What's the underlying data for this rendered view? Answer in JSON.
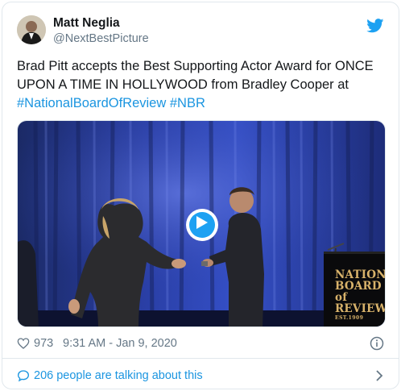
{
  "author": {
    "name": "Matt Neglia",
    "handle": "@NextBestPicture"
  },
  "tweet": {
    "text_plain": "Brad Pitt accepts the Best Supporting Actor Award for ONCE UPON A TIME IN HOLLYWOOD from Bradley Cooper at",
    "hashtags": [
      "#NationalBoardOfReview",
      "#NBR"
    ]
  },
  "media": {
    "type": "video",
    "sign_lines": [
      "NATIONA",
      "BOARD of",
      "REVIEW"
    ],
    "sign_est": "EST.1909"
  },
  "meta": {
    "like_count": "973",
    "timestamp": "9:31 AM - Jan 9, 2020"
  },
  "conversation": {
    "label": "206 people are talking about this"
  },
  "icons": {
    "bird": "twitter-bird-icon",
    "heart": "heart-icon",
    "info": "info-icon",
    "bubble": "chat-bubble-icon",
    "chevron": "chevron-right-icon",
    "play": "play-icon"
  },
  "colors": {
    "link": "#1b95e0",
    "brand": "#1da1f2",
    "secondary_text": "#657786",
    "border": "#e1e8ed"
  }
}
